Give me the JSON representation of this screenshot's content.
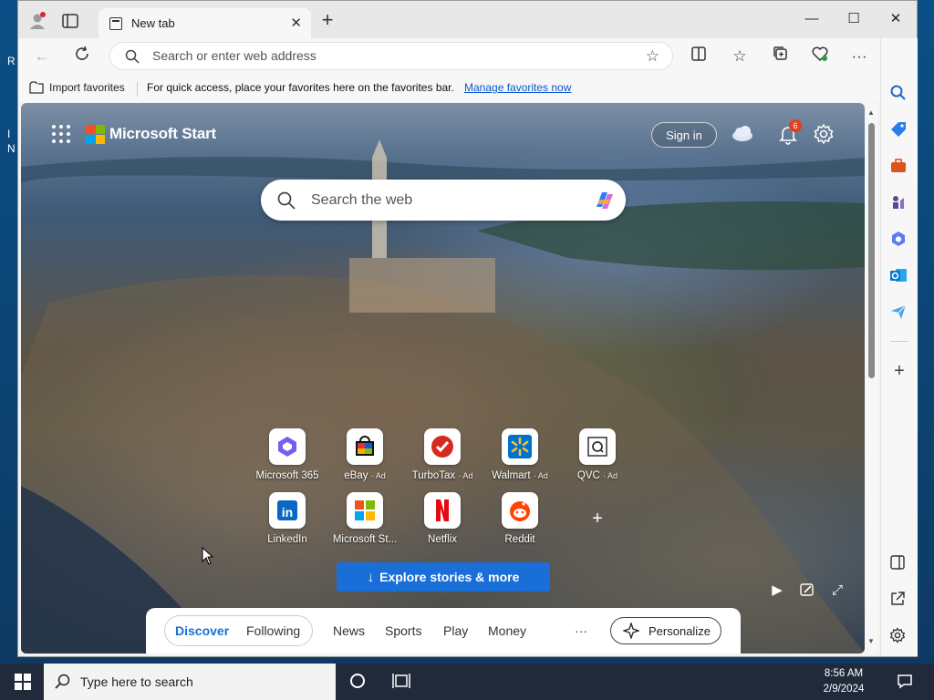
{
  "browser": {
    "tab_title": "New tab",
    "address_placeholder": "Search or enter web address",
    "favorites": {
      "import_label": "Import favorites",
      "message": "For quick access, place your favorites here on the favorites bar.",
      "manage_link": "Manage favorites now"
    }
  },
  "msn": {
    "brand": "Microsoft Start",
    "sign_in": "Sign in",
    "notification_count": "6",
    "search_placeholder": "Search the web",
    "tiles": [
      {
        "label": "Microsoft 365",
        "ad": "",
        "icon": "microsoft365-icon"
      },
      {
        "label": "eBay",
        "ad": "· Ad",
        "icon": "ebay-icon"
      },
      {
        "label": "TurboTax",
        "ad": "· Ad",
        "icon": "turbotax-icon"
      },
      {
        "label": "Walmart",
        "ad": "· Ad",
        "icon": "walmart-icon"
      },
      {
        "label": "QVC",
        "ad": "· Ad",
        "icon": "qvc-icon"
      },
      {
        "label": "LinkedIn",
        "ad": "",
        "icon": "linkedin-icon"
      },
      {
        "label": "Microsoft St...",
        "ad": "",
        "icon": "microsoft-store-icon"
      },
      {
        "label": "Netflix",
        "ad": "",
        "icon": "netflix-icon"
      },
      {
        "label": "Reddit",
        "ad": "",
        "icon": "reddit-icon"
      }
    ],
    "explore_label": "Explore stories & more",
    "feed_tabs": {
      "discover": "Discover",
      "following": "Following",
      "news": "News",
      "sports": "Sports",
      "play": "Play",
      "money": "Money",
      "more": "···"
    },
    "personalize": "Personalize"
  },
  "taskbar": {
    "search_placeholder": "Type here to search",
    "time": "8:56 AM",
    "date": "2/9/2024"
  },
  "colors": {
    "accent": "#1a6ed8",
    "taskbar": "#202a3b",
    "badge": "#e0401f"
  }
}
